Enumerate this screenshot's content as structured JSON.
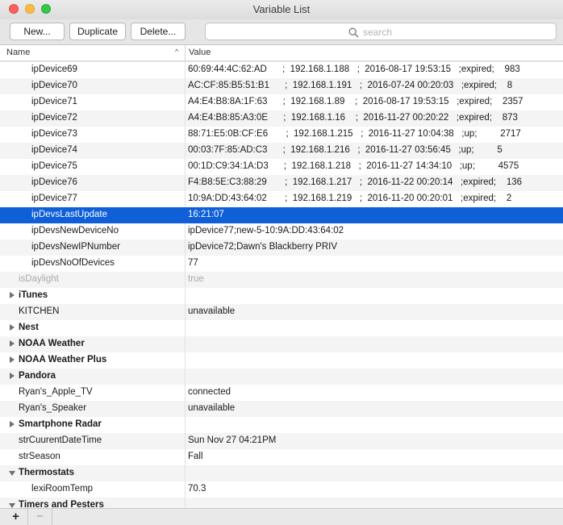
{
  "window": {
    "title": "Variable List"
  },
  "toolbar": {
    "new_label": "New...",
    "duplicate_label": "Duplicate",
    "delete_label": "Delete...",
    "search_placeholder": "search"
  },
  "columns": {
    "name": "Name",
    "value": "Value"
  },
  "rows": [
    {
      "name": "ipDevice69",
      "value": "60:69:44:4C:62:AD      ;  192.168.1.188   ;  2016-08-17 19:53:15   ;expired;    983",
      "level": 2
    },
    {
      "name": "ipDevice70",
      "value": "AC:CF:85:B5:51:B1      ;  192.168.1.191   ;  2016-07-24 00:20:03   ;expired;    8",
      "level": 2
    },
    {
      "name": "ipDevice71",
      "value": "A4:E4:B8:8A:1F:63      ;  192.168.1.89    ;  2016-08-17 19:53:15   ;expired;    2357",
      "level": 2
    },
    {
      "name": "ipDevice72",
      "value": "A4:E4:B8:85:A3:0E      ;  192.168.1.16    ;  2016-11-27 00:20:22   ;expired;    873",
      "level": 2
    },
    {
      "name": "ipDevice73",
      "value": "88:71:E5:0B:CF:E6       ;  192.168.1.215   ;  2016-11-27 10:04:38   ;up;         2717",
      "level": 2
    },
    {
      "name": "ipDevice74",
      "value": "00:03:7F:85:AD:C3      ;  192.168.1.216   ;  2016-11-27 03:56:45   ;up;         5",
      "level": 2
    },
    {
      "name": "ipDevice75",
      "value": "00:1D:C9:34:1A:D3      ;  192.168.1.218   ;  2016-11-27 14:34:10   ;up;         4575",
      "level": 2
    },
    {
      "name": "ipDevice76",
      "value": "F4:B8:5E:C3:88:29       ;  192.168.1.217   ;  2016-11-22 00:20:14   ;expired;    136",
      "level": 2
    },
    {
      "name": "ipDevice77",
      "value": "10:9A:DD:43:64:02       ;  192.168.1.219   ;  2016-11-20 00:20:01   ;expired;    2",
      "level": 2
    },
    {
      "name": "ipDevsLastUpdate",
      "value": "16:21:07",
      "level": 2,
      "selected": true
    },
    {
      "name": "ipDevsNewDeviceNo",
      "value": "ipDevice77;new-5-10:9A:DD:43:64:02",
      "level": 2
    },
    {
      "name": "ipDevsNewIPNumber",
      "value": "ipDevice72;Dawn's Blackberry PRIV",
      "level": 2
    },
    {
      "name": "ipDevsNoOfDevices",
      "value": "77",
      "level": 2
    },
    {
      "name": "isDaylight",
      "value": "true",
      "level": 1,
      "dimmed": true
    },
    {
      "name": "iTunes",
      "value": "",
      "group": "collapsed"
    },
    {
      "name": "KITCHEN",
      "value": "unavailable",
      "level": 1
    },
    {
      "name": "Nest",
      "value": "",
      "group": "collapsed"
    },
    {
      "name": "NOAA Weather",
      "value": "",
      "group": "collapsed"
    },
    {
      "name": "NOAA Weather Plus",
      "value": "",
      "group": "collapsed"
    },
    {
      "name": "Pandora",
      "value": "",
      "group": "collapsed"
    },
    {
      "name": "Ryan's_Apple_TV",
      "value": "connected",
      "level": 1
    },
    {
      "name": "Ryan's_Speaker",
      "value": "unavailable",
      "level": 1
    },
    {
      "name": "Smartphone Radar",
      "value": "",
      "group": "collapsed"
    },
    {
      "name": "strCuurentDateTime",
      "value": "Sun Nov 27 04:21PM",
      "level": 1
    },
    {
      "name": "strSeason",
      "value": "Fall",
      "level": 1
    },
    {
      "name": "Thermostats",
      "value": "",
      "group": "expanded"
    },
    {
      "name": "lexiRoomTemp",
      "value": "70.3",
      "level": 2
    },
    {
      "name": "Timers and Pesters",
      "value": "",
      "group": "expanded"
    }
  ],
  "bottom": {
    "add_label": "+",
    "remove_label": "−"
  },
  "colors": {
    "selection": "#0e5fd8",
    "stripe": "#f4f4f5"
  }
}
